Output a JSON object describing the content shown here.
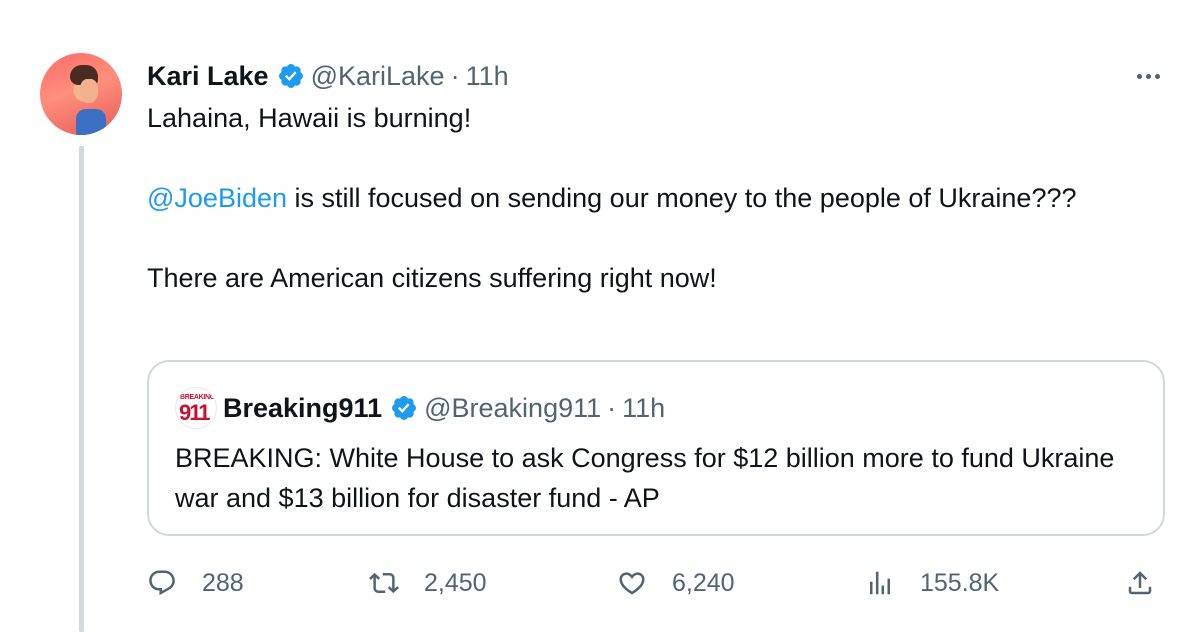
{
  "tweet": {
    "author_name": "Kari Lake",
    "author_handle": "@KariLake",
    "separator": "·",
    "time": "11h",
    "line1": "Lahaina, Hawaii is burning!",
    "mention": "@JoeBiden",
    "line2_rest": " is still focused on sending our money to the people of Ukraine???",
    "line3": "There are American citizens suffering right now!"
  },
  "quoted_tweet": {
    "author_name": "Breaking911",
    "author_handle": "@Breaking911",
    "separator": "·",
    "time": "11h",
    "avatar_small": "BREAKING",
    "avatar_big": "911",
    "text": "BREAKING: White House to ask Congress for $12 billion more to fund Ukraine war and $13 billion for disaster fund - AP"
  },
  "actions": {
    "replies": "288",
    "retweets": "2,450",
    "likes": "6,240",
    "views": "155.8K"
  },
  "colors": {
    "link": "#1d9bf0",
    "verified": "#1d9bf0",
    "muted": "#536471",
    "border": "#cfd9de"
  },
  "icons": [
    "more-icon",
    "verified-badge-icon",
    "reply-icon",
    "retweet-icon",
    "like-icon",
    "views-icon",
    "share-icon"
  ]
}
